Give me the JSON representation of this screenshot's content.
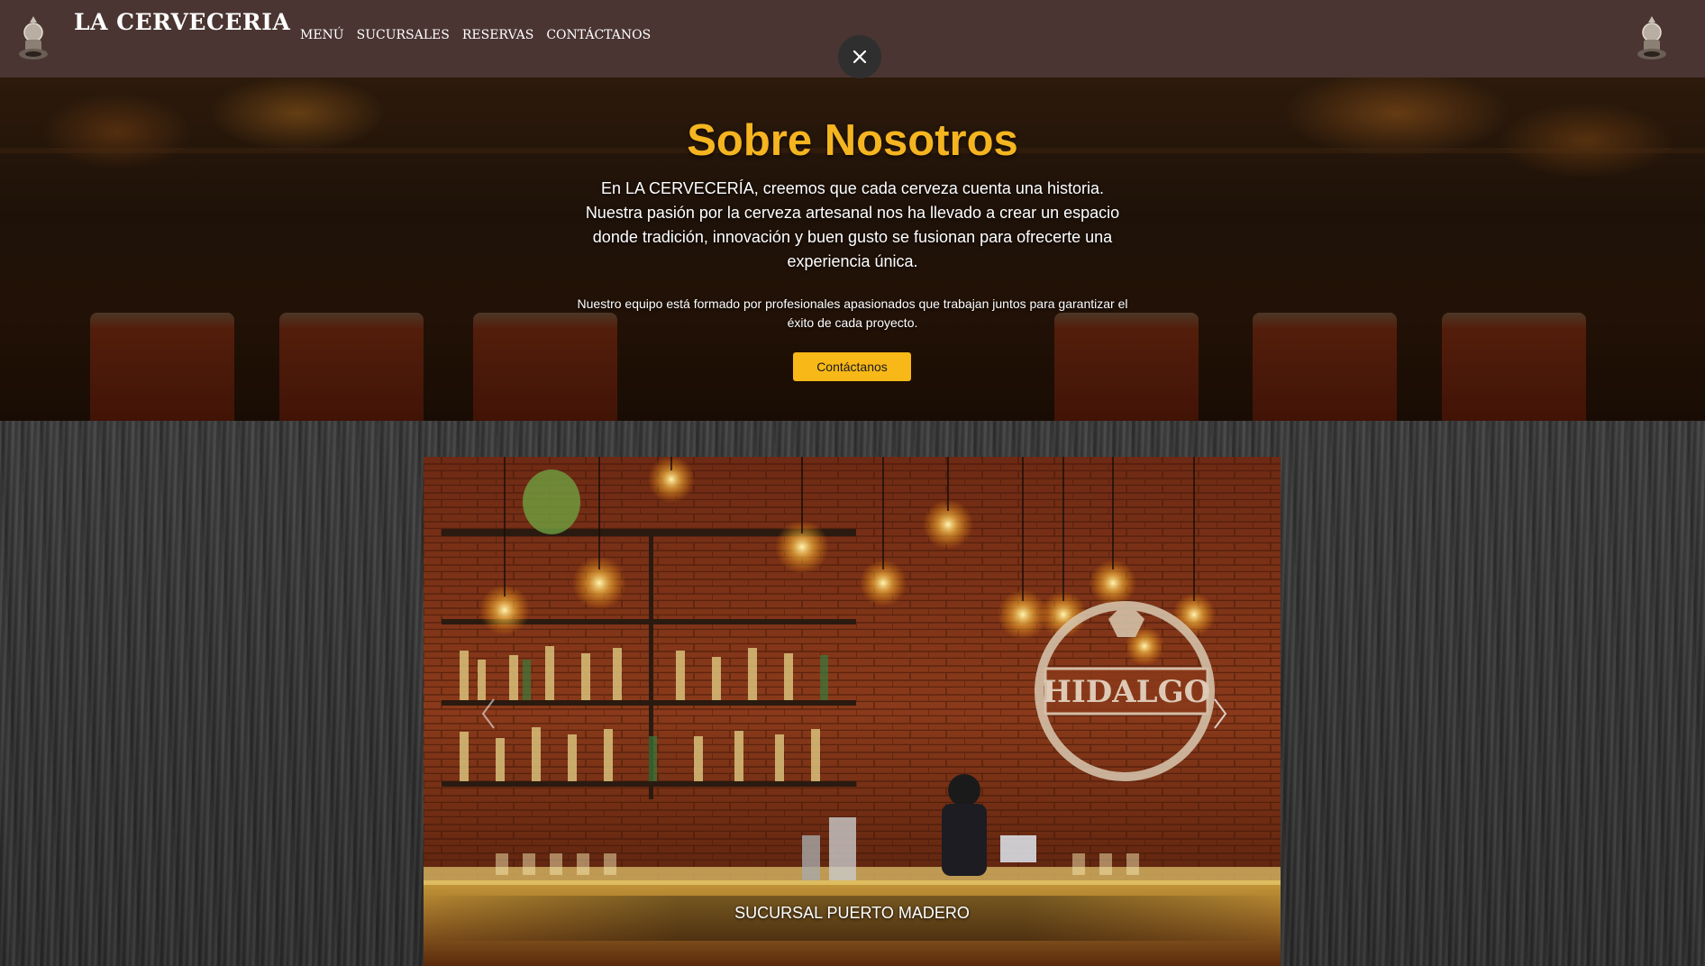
{
  "navbar": {
    "brand": "LA CERVECERIA",
    "links": [
      "MENÚ",
      "SUCURSALES",
      "RESERVAS",
      "CONTÁCTANOS"
    ],
    "logo_icon": "beer-crest-logo",
    "close_icon": "close-icon"
  },
  "hero": {
    "title": "Sobre Nosotros",
    "lead": "En LA CERVECERÍA, creemos que cada cerveza cuenta una historia. Nuestra pasión por la cerveza artesanal nos ha llevado a crear un espacio donde tradición, innovación y buen gusto se fusionan para ofrecerte una experiencia única.",
    "sub": "Nuestro equipo está formado por profesionales apasionados que trabajan juntos para garantizar el éxito de cada proyecto.",
    "button": "Contáctanos"
  },
  "carousel": {
    "caption": "SUCURSAL PUERTO MADERO",
    "sign_text": "HIDALGO",
    "prev_icon": "chevron-left-icon",
    "next_icon": "chevron-right-icon"
  },
  "colors": {
    "navbar_bg": "#4a3532",
    "accent": "#f5b520",
    "button_bg": "#f8b818"
  }
}
